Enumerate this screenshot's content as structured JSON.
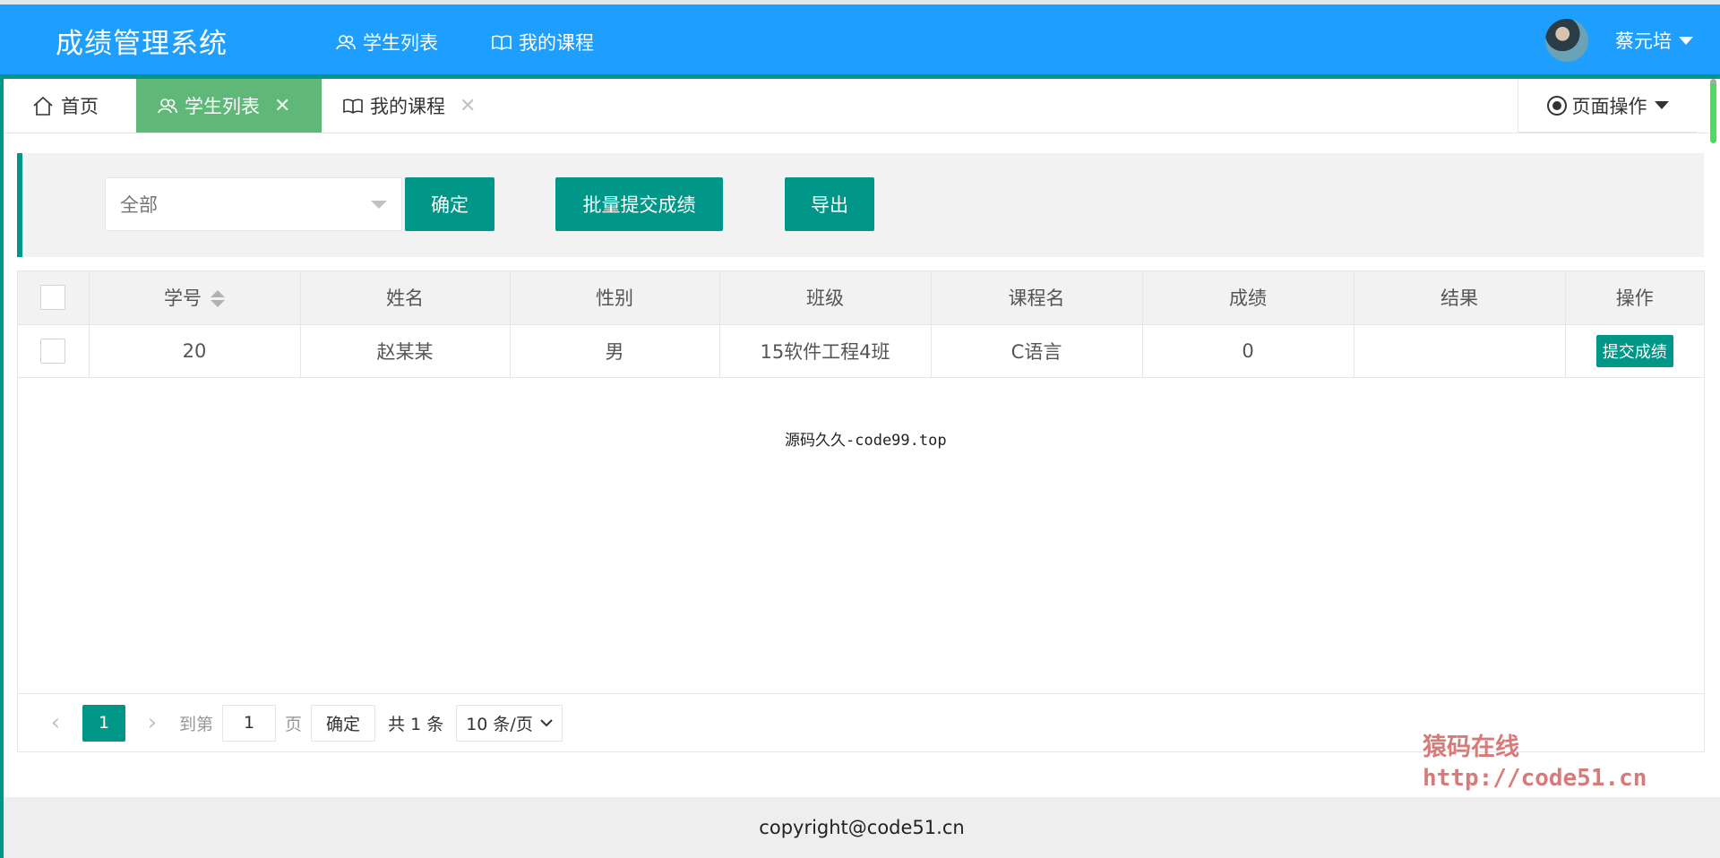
{
  "header": {
    "brand": "成绩管理系统",
    "nav": [
      {
        "label": "学生列表",
        "icon": "users-icon",
        "active": true
      },
      {
        "label": "我的课程",
        "icon": "book-icon",
        "active": false
      }
    ],
    "user": {
      "name": "蔡元培"
    }
  },
  "tabs": [
    {
      "label": "首页",
      "icon": "home-icon"
    },
    {
      "label": "学生列表",
      "icon": "users-icon",
      "active": true,
      "close": "✕"
    },
    {
      "label": "我的课程",
      "icon": "book-icon",
      "close": "✕"
    }
  ],
  "page_ops": {
    "label": "页面操作"
  },
  "filter": {
    "select_value": "全部",
    "confirm_label": "确定",
    "batch_label": "批量提交成绩",
    "export_label": "导出"
  },
  "table": {
    "columns": [
      "学号",
      "姓名",
      "性别",
      "班级",
      "课程名",
      "成绩",
      "结果",
      "操作"
    ],
    "rows": [
      {
        "id": "20",
        "name": "赵某某",
        "gender": "男",
        "class": "15软件工程4班",
        "course": "C语言",
        "score": "0",
        "result": "",
        "action": "提交成绩"
      }
    ]
  },
  "notice": "源码久久-code99.top",
  "pager": {
    "prev": "‹",
    "current": "1",
    "next": "›",
    "goto_label": "到第",
    "page_input": "1",
    "page_unit": "页",
    "confirm": "确定",
    "total": "共 1 条",
    "page_size": "10 条/页"
  },
  "footer": {
    "copyright": "copyright@code51.cn"
  },
  "watermark": {
    "line1": "猿码在线",
    "line2": "http://code51.cn"
  },
  "colors": {
    "primary": "#1e9fff",
    "teal": "#009688",
    "green": "#5fb878"
  }
}
